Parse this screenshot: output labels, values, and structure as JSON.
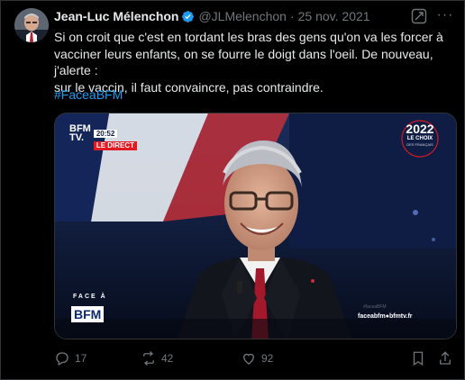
{
  "tweet": {
    "author_name": "Jean-Luc Mélenchon",
    "handle": "@JLMelenchon",
    "separator": "·",
    "date": "25 nov. 2021",
    "text_line1": "Si on croit que c'est en tordant les bras des gens qu'on va les forcer à",
    "text_line2": "vacciner leurs enfants, on se fourre le doigt dans l'oeil. De nouveau, j'alerte :",
    "text_line3": "sur le vaccin, il faut convaincre, pas contraindre.",
    "hashtag": "#FaceaBFM",
    "more_label": "···"
  },
  "media": {
    "channel": "BFM\nTV.",
    "channel_line1": "BFM",
    "channel_line2": "TV.",
    "live_time": "20:52",
    "live_label": "LE DIRECT",
    "badge_year": "2022",
    "badge_sub1": "LE CHOIX",
    "badge_sub2": "DES FRANÇAIS",
    "face_a": "FACE À",
    "face_bfm": "BFM",
    "face_url": "faceabfm●bfmtv.fr",
    "face_replay": "#faceaBFM"
  },
  "actions": {
    "replies": "17",
    "reposts": "42",
    "likes": "92"
  },
  "colors": {
    "background": "#000000",
    "text": "#e7e9ea",
    "muted": "#71767b",
    "link": "#1d9bf0",
    "verified": "#1d9bf0",
    "bfm_red": "#e21b23"
  }
}
